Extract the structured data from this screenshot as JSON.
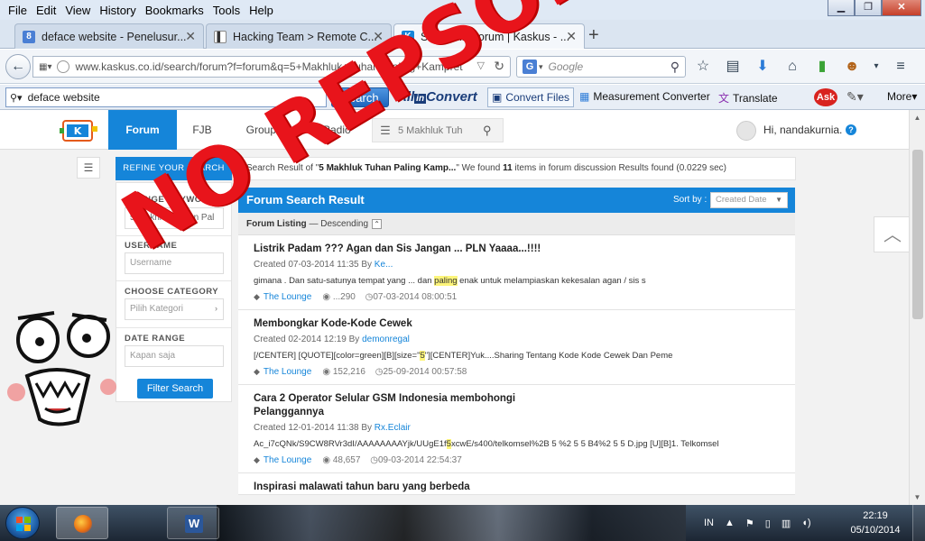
{
  "menubar": {
    "items": [
      "File",
      "Edit",
      "View",
      "History",
      "Bookmarks",
      "Tools",
      "Help"
    ]
  },
  "tabs": [
    {
      "label": "deface website - Penelusur...",
      "favicon": "g-favicon",
      "color": "#4a7fd4"
    },
    {
      "label": "Hacking Team > Remote C...",
      "favicon": "page-favicon",
      "color": "#555555"
    },
    {
      "label": "Search in Forum | Kaskus - ...",
      "favicon": "kaskus-favicon",
      "color": "#1585d9"
    }
  ],
  "navbar": {
    "url_host": "www.kaskus.co.id",
    "url_path": "/search/forum?f=forum&q=5+Makhluk+Tuhan+Paling+Kampret",
    "search_engine": "G",
    "search_placeholder": "Google"
  },
  "toolbar": {
    "search_value": "deface website",
    "search_button": "Search",
    "allin_brand_1": "All",
    "allin_brand_2": "in",
    "allin_brand_3": "Convert",
    "convert_files": "Convert Files",
    "measurement": "Measurement Converter",
    "translate": "Translate",
    "ask": "Ask",
    "more": "More"
  },
  "kaskus": {
    "nav": [
      "Forum",
      "FJB",
      "Groupee",
      "Radio"
    ],
    "search_query": "5 Makhluk Tuh",
    "greeting": "Hi, nandakurnia.",
    "refine": "REFINE YOUR SEARCH",
    "info_prefix": "Search Result of \"",
    "info_query": "5 Makhluk Tuhan Paling Kamp...",
    "info_mid": "\" We found ",
    "info_count": "11",
    "info_suffix": " items in forum discussion Results found (0.0229 sec)",
    "sidebar": {
      "change_keyword": "CHANGE KEYWORD",
      "keyword_value": "5 Makhluk Tuhan Pal",
      "username": "USERNAME",
      "username_placeholder": "Username",
      "category": "CHOOSE CATEGORY",
      "category_placeholder": "Pilih Kategori",
      "date_range": "DATE RANGE",
      "date_placeholder": "Kapan saja",
      "filter_button": "Filter Search"
    },
    "results_title": "Forum Search Result",
    "sort_by": "Sort by :",
    "sort_value": "Created Date",
    "listing_label": "Forum Listing",
    "listing_sep": " — ",
    "listing_order": "Descending",
    "items": [
      {
        "title": "Listrik Padam ??? Agan dan Sis Jangan ... PLN Yaaaa...!!!!",
        "created": "Created 07-03-2014 11:35 By ",
        "user": "Ke...",
        "snippet_a": "gimana . Dan satu-satunya tempat yang ... dan ",
        "snippet_hl": "paling",
        "snippet_b": " enak untuk melampiaskan kekesalan agan / sis s",
        "forum": "The Lounge",
        "views": "...290",
        "date": "07-03-2014 08:00:51"
      },
      {
        "title": "Membongkar Kode-Kode Cewek",
        "created": "Created 02-2014 12:19 By ",
        "user": "demonregal",
        "snippet_a": "[/CENTER] [QUOTE][color=green][B][size=\"",
        "snippet_hl": "5",
        "snippet_b": "\"][CENTER]Yuk....Sharing Tentang Kode Kode Cewek Dan Peme",
        "forum": "The Lounge",
        "views": "152,216",
        "date": "25-09-2014 00:57:58"
      },
      {
        "title": "Cara 2 Operator Selular GSM Indonesia membohongi Pelanggannya",
        "created": "Created 12-01-2014 11:38 By ",
        "user": "Rx.Eclair",
        "snippet_a": "Ac_i7cQNk/S9CW8RVr3dI/AAAAAAAAYjk/UUgE1f",
        "snippet_hl": "5",
        "snippet_b": "xcwE/s400/telkomsel%2B 5 %2 5 5 B4%2 5 5 D.jpg [U][B]1. Telkomsel",
        "forum": "The Lounge",
        "views": "48,657",
        "date": "09-03-2014 22:54:37"
      },
      {
        "title": "Inspirasi malawati tahun baru yang berbeda",
        "created": "",
        "user": "",
        "snippet_a": "",
        "snippet_hl": "",
        "snippet_b": "",
        "forum": "",
        "views": "",
        "date": ""
      }
    ]
  },
  "overlay": {
    "text": "NO REPSOL GAN !",
    "color": "#e8141b"
  },
  "taskbar": {
    "lang": "IN",
    "time": "22:19",
    "date": "05/10/2014"
  }
}
